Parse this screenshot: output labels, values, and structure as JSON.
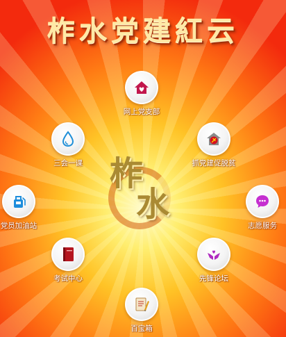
{
  "app": {
    "title": "柞水党建紅云"
  },
  "logo": {
    "char1": "柞",
    "char2": "水"
  },
  "menu": [
    {
      "id": "online-branch",
      "label": "网上党支部",
      "icon": "house-heart-icon"
    },
    {
      "id": "three-meetings",
      "label": "三会一课",
      "icon": "water-drop-icon"
    },
    {
      "id": "poverty",
      "label": "抓党建促脱贫",
      "icon": "party-emblem-house-icon"
    },
    {
      "id": "gas-station",
      "label": "党员加油站",
      "icon": "fuel-pump-icon"
    },
    {
      "id": "volunteer",
      "label": "志愿服务",
      "icon": "chat-bubble-icon"
    },
    {
      "id": "exam",
      "label": "考试中心",
      "icon": "book-icon"
    },
    {
      "id": "forum",
      "label": "先锋论坛",
      "icon": "hands-heart-icon"
    },
    {
      "id": "toolbox",
      "label": "百宝箱",
      "icon": "notebook-pencil-icon"
    }
  ],
  "colors": {
    "background_outer": "#f32a0d",
    "background_center": "#fffbd0",
    "title": "#ffe9a6"
  }
}
